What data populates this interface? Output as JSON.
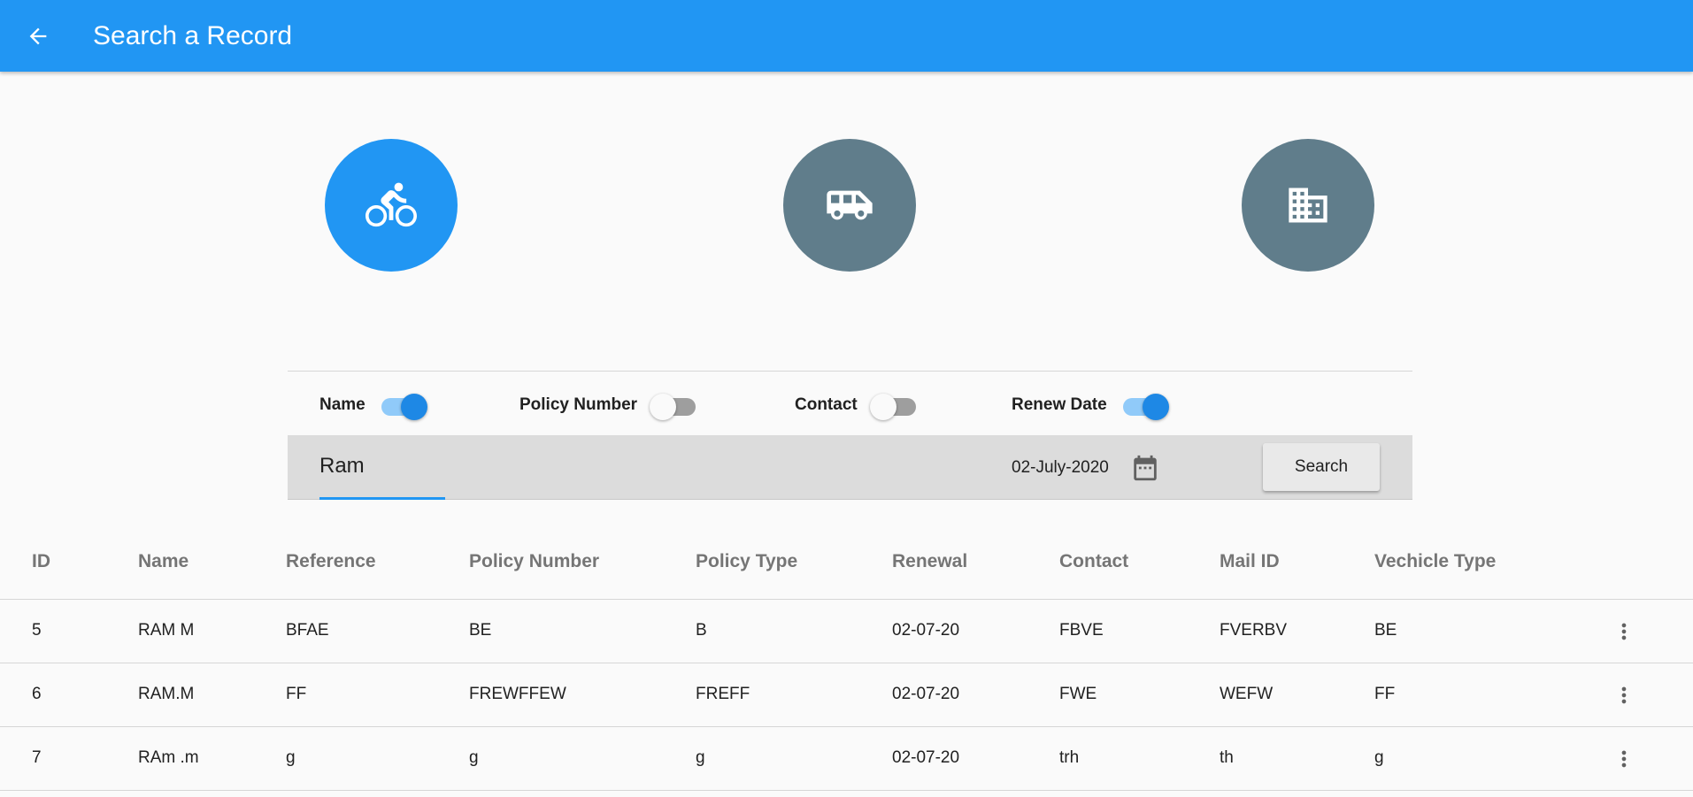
{
  "appbar": {
    "title": "Search a Record",
    "color": "#2196f3",
    "back_icon": "arrow-back-icon"
  },
  "categories": [
    {
      "icon": "bicycle-icon",
      "active": true
    },
    {
      "icon": "van-icon",
      "active": false
    },
    {
      "icon": "building-icon",
      "active": false
    }
  ],
  "filters": {
    "name": {
      "label": "Name",
      "on": true
    },
    "policy_number": {
      "label": "Policy Number",
      "on": false
    },
    "contact": {
      "label": "Contact",
      "on": false
    },
    "renew_date": {
      "label": "Renew Date",
      "on": true
    }
  },
  "search": {
    "name_value": "Ram",
    "date_value": "02-July-2020",
    "calendar_icon": "calendar-icon",
    "button_label": "Search"
  },
  "table": {
    "columns": [
      "ID",
      "Name",
      "Reference",
      "Policy Number",
      "Policy Type",
      "Renewal",
      "Contact",
      "Mail ID",
      "Vechicle Type"
    ],
    "rows": [
      [
        "5",
        "RAM M",
        "BFAE",
        "BE",
        "B",
        "02-07-20",
        "FBVE",
        "FVERBV",
        "BE"
      ],
      [
        "6",
        "RAM.M",
        "FF",
        "FREWFFEW",
        "FREFF",
        "02-07-20",
        "FWE",
        "WEFW",
        "FF"
      ],
      [
        "7",
        "RAm .m",
        "g",
        "g",
        "g",
        "02-07-20",
        "trh",
        "th",
        "g"
      ]
    ],
    "row_menu_icon": "more-vertical-icon"
  }
}
